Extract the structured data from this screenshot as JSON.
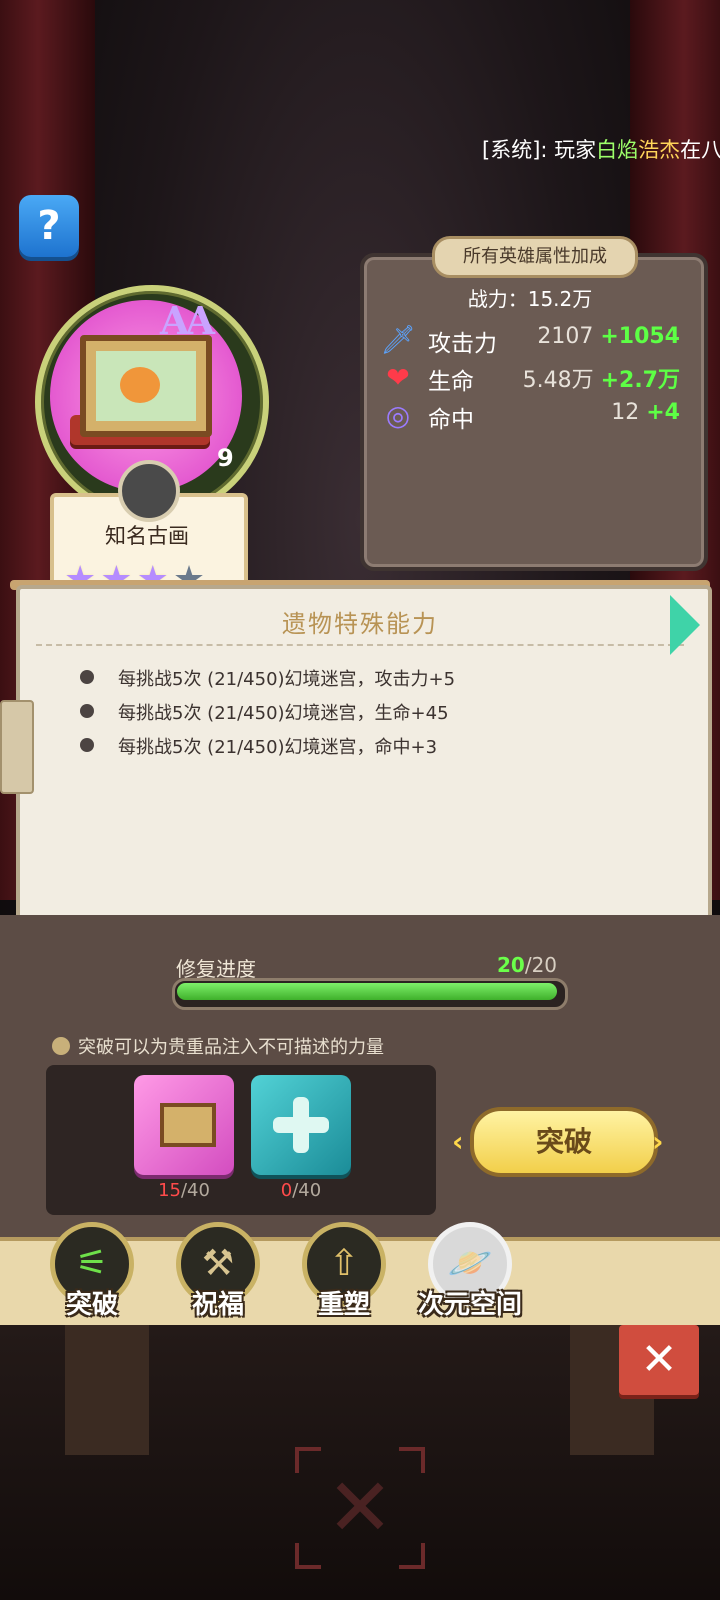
{
  "system_message": {
    "prefix": "[系统]: 玩家",
    "player_part1": "白焰",
    "player_part2": "浩杰",
    "suffix": "在八"
  },
  "help_button": "?",
  "relic": {
    "aa_mark": "AA",
    "level": "9",
    "name": "知名古画",
    "stars_filled": 3,
    "stars_total": 4
  },
  "stats": {
    "title": "所有英雄属性加成",
    "power": "战力：15.2万",
    "rows": [
      {
        "icon": "sword-icon",
        "label": "攻击力",
        "value": "2107",
        "bonus": "+1054"
      },
      {
        "icon": "heart-icon",
        "label": "生命",
        "value": "5.48万",
        "bonus": "+2.7万"
      },
      {
        "icon": "target-icon",
        "label": "命中",
        "value": "12",
        "bonus": "+4"
      }
    ]
  },
  "abilities": {
    "title": "遗物特殊能力",
    "items": [
      "每挑战5次 (21/450)幻境迷宫，攻击力+5",
      "每挑战5次 (21/450)幻境迷宫，生命+45",
      "每挑战5次 (21/450)幻境迷宫，命中+3"
    ]
  },
  "repair": {
    "label": "修复进度",
    "current": "20",
    "total": "/20",
    "progress_fraction": 1.0
  },
  "breakthrough": {
    "tip": "突破可以为贵重品注入不可描述的力量",
    "materials": [
      {
        "icon": "painting-icon",
        "have": "15",
        "need": "/40"
      },
      {
        "icon": "cross-gem-icon",
        "have": "0",
        "need": "/40"
      }
    ],
    "button_label": "突破",
    "arrow_left": "‹",
    "arrow_right": "›"
  },
  "nav": [
    {
      "id": "breakthrough",
      "label": "突破",
      "icon": "claw-icon"
    },
    {
      "id": "bless",
      "label": "祝福",
      "icon": "hammer-icon"
    },
    {
      "id": "reshape",
      "label": "重塑",
      "icon": "arrow-up-icon"
    },
    {
      "id": "dimension",
      "label": "次元空间",
      "icon": "planet-icon"
    }
  ],
  "colors": {
    "bonus_green": "#5dff45",
    "progress_green": "#6bff4a",
    "need_red": "#ff4b4b",
    "accent_gold": "#f2cf4a"
  }
}
